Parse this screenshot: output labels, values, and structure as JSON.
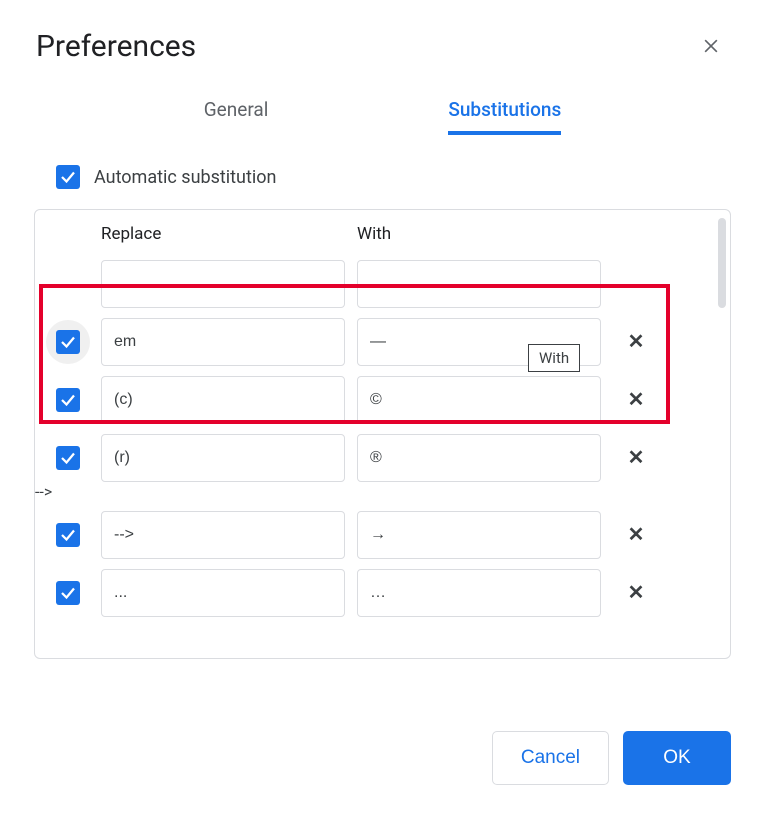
{
  "dialog": {
    "title": "Preferences"
  },
  "tabs": {
    "general": "General",
    "substitutions": "Substitutions"
  },
  "auto_sub": {
    "label": "Automatic substitution",
    "checked": true
  },
  "columns": {
    "replace": "Replace",
    "with": "With"
  },
  "tooltip": "With",
  "rows": [
    {
      "enabled": null,
      "replace": "",
      "with": "",
      "deletable": false
    },
    {
      "enabled": true,
      "replace": "em",
      "with": "—",
      "deletable": true,
      "halo": true
    },
    {
      "enabled": true,
      "replace": "(c)",
      "with": "©",
      "deletable": true
    },
    {
      "enabled": true,
      "replace": "(r)",
      "with": "®",
      "deletable": true
    },
    {
      "enabled": true,
      "replace": "-->",
      "with": "→",
      "deletable": true
    },
    {
      "enabled": true,
      "replace": "...",
      "with": "…",
      "deletable": true
    }
  ],
  "buttons": {
    "cancel": "Cancel",
    "ok": "OK"
  }
}
